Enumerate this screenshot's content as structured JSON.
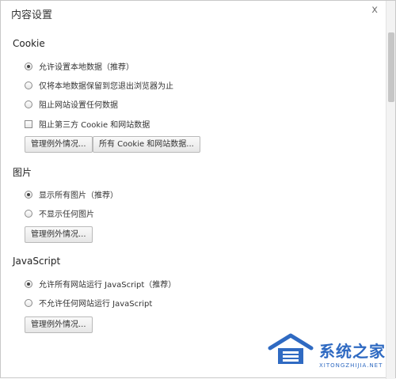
{
  "dialog": {
    "title": "内容设置",
    "close_label": "x"
  },
  "sections": {
    "cookie": {
      "title": "Cookie",
      "options": [
        "允许设置本地数据（推荐）",
        "仅将本地数据保留到您退出浏览器为止",
        "阻止网站设置任何数据"
      ],
      "checkbox_label": "阻止第三方 Cookie 和网站数据",
      "manage_button": "管理例外情况...",
      "all_data_button": "所有 Cookie 和网站数据..."
    },
    "images": {
      "title": "图片",
      "options": [
        "显示所有图片（推荐）",
        "不显示任何图片"
      ],
      "manage_button": "管理例外情况..."
    },
    "javascript": {
      "title": "JavaScript",
      "options": [
        "允许所有网站运行 JavaScript（推荐）",
        "不允许任何网站运行 JavaScript"
      ],
      "manage_button": "管理例外情况..."
    }
  },
  "watermark": {
    "main": "系统之家",
    "sub": "XITONGZHIJIA.NET"
  },
  "colors": {
    "accent": "#2f6ac2",
    "border": "#c8c8c8"
  }
}
